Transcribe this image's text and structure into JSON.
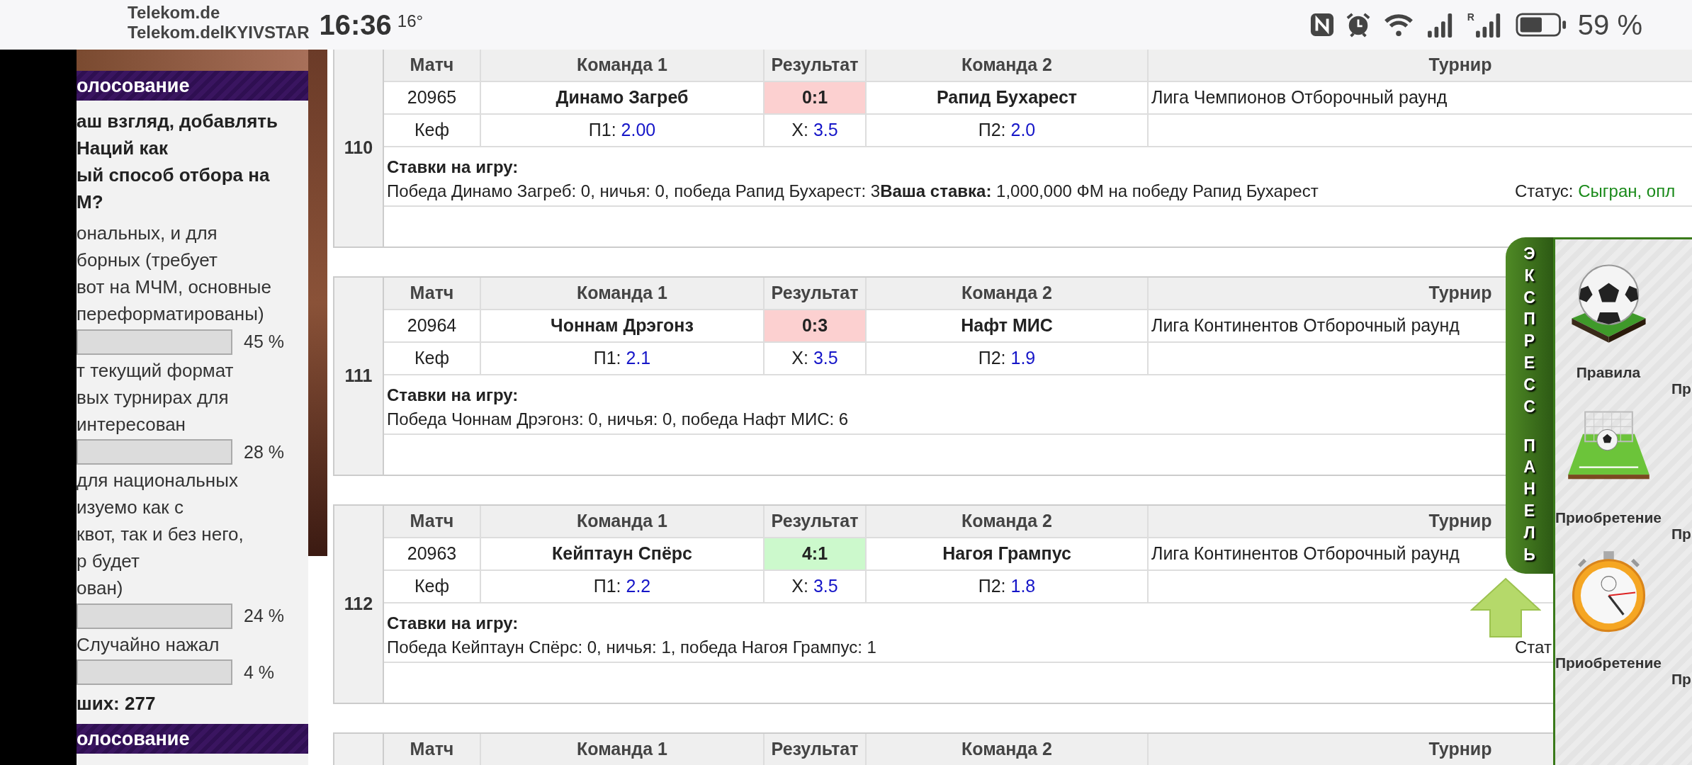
{
  "status_bar": {
    "carriers": [
      "Telekom.de",
      "Telekom.delKYIVSTAR"
    ],
    "time": "16:36",
    "temperature": "16°",
    "roaming_mark": "R",
    "battery": "59 %"
  },
  "sidebar": {
    "poll_header": "олосование",
    "question_lines": [
      "аш взгляд, добавлять",
      "Наций как",
      "ый способ отбора на",
      "М?"
    ],
    "options": [
      {
        "lines": [
          "ональных, и для",
          "борных (требует",
          "вот на МЧМ, основные",
          "переформатированы)"
        ],
        "percent": "45 %"
      },
      {
        "lines": [
          "т текущий формат",
          "вых турнирах для",
          "интересован"
        ],
        "percent": "28 %"
      },
      {
        "lines": [
          "для национальных",
          "изуемо как с",
          "квот, так и без него,",
          "р будет",
          "ован)"
        ],
        "percent": "24 %"
      },
      {
        "lines": [
          "Случайно нажал"
        ],
        "percent": "4 %"
      }
    ],
    "total": "ших: 277",
    "footer_header": "олосование"
  },
  "matches": [
    {
      "number": "110",
      "columns": [
        "Матч",
        "Команда 1",
        "Результат",
        "Команда 2",
        "Турнир"
      ],
      "match_id": "20965",
      "team1": "Динамо Загреб",
      "result": "0:1",
      "color": "#fcd0d0",
      "team2": "Рапид Бухарест",
      "tournament": "Лига Чемпионов Отборочный раунд",
      "odds_label": "Кеф",
      "odds": [
        {
          "label": "П1:",
          "value": "2.00"
        },
        {
          "label": "Х:",
          "value": "3.5"
        },
        {
          "label": "П2:",
          "value": "2.0"
        }
      ],
      "bets_title": "Ставки на игру:",
      "bets_text": "Победа Динамо Загреб: 0, ничья: 0, победа Рапид Бухарест: 3**Ваша ставка:** 1,000,000 ФМ на победу Рапид Бухарест",
      "status_label": "Статус:",
      "status_value": "Сыгран, опл"
    },
    {
      "number": "111",
      "columns": [
        "Матч",
        "Команда 1",
        "Результат",
        "Команда 2",
        "Турнир"
      ],
      "match_id": "20964",
      "team1": "Чоннам Дрэгонз",
      "result": "0:3",
      "color": "#fcd0d0",
      "team2": "Нафт МИС",
      "tournament": "Лига Континентов Отборочный раунд",
      "odds_label": "Кеф",
      "odds": [
        {
          "label": "П1:",
          "value": "2.1"
        },
        {
          "label": "Х:",
          "value": "3.5"
        },
        {
          "label": "П2:",
          "value": "1.9"
        }
      ],
      "bets_title": "Ставки на игру:",
      "bets_text": "Победа Чоннам Дрэгонз: 0, ничья: 0, победа Нафт МИС: 6"
    },
    {
      "number": "112",
      "columns": [
        "Матч",
        "Команда 1",
        "Результат",
        "Команда 2",
        "Турнир"
      ],
      "match_id": "20963",
      "team1": "Кейптаун Спёрс",
      "result": "4:1",
      "color": "#ccf9cc",
      "team2": "Нагоя Грампус",
      "tournament": "Лига Континентов Отборочный раунд",
      "odds_label": "Кеф",
      "odds": [
        {
          "label": "П1:",
          "value": "2.2"
        },
        {
          "label": "Х:",
          "value": "3.5"
        },
        {
          "label": "П2:",
          "value": "1.8"
        }
      ],
      "bets_title": "Ставки на игру:",
      "bets_text": "Победа Кейптаун Спёрс: 0, ничья: 1, победа Нагоя Грампус: 1",
      "status_label": "Стат"
    },
    {
      "columns": [
        "Матч",
        "Команда 1",
        "Результат",
        "Команда 2",
        "Турнир"
      ]
    }
  ],
  "express_panel": {
    "tab_words": [
      "ЭКСПРЕСС",
      "ПАНЕЛЬ"
    ],
    "items": [
      {
        "kind": "ball",
        "label": "Правила",
        "cut_label": "Пр"
      },
      {
        "kind": "goal",
        "label": "Приобретение",
        "cut_label": "Пр"
      },
      {
        "kind": "stopwatch",
        "label": "Приобретение",
        "cut_label": "Пр"
      }
    ]
  }
}
